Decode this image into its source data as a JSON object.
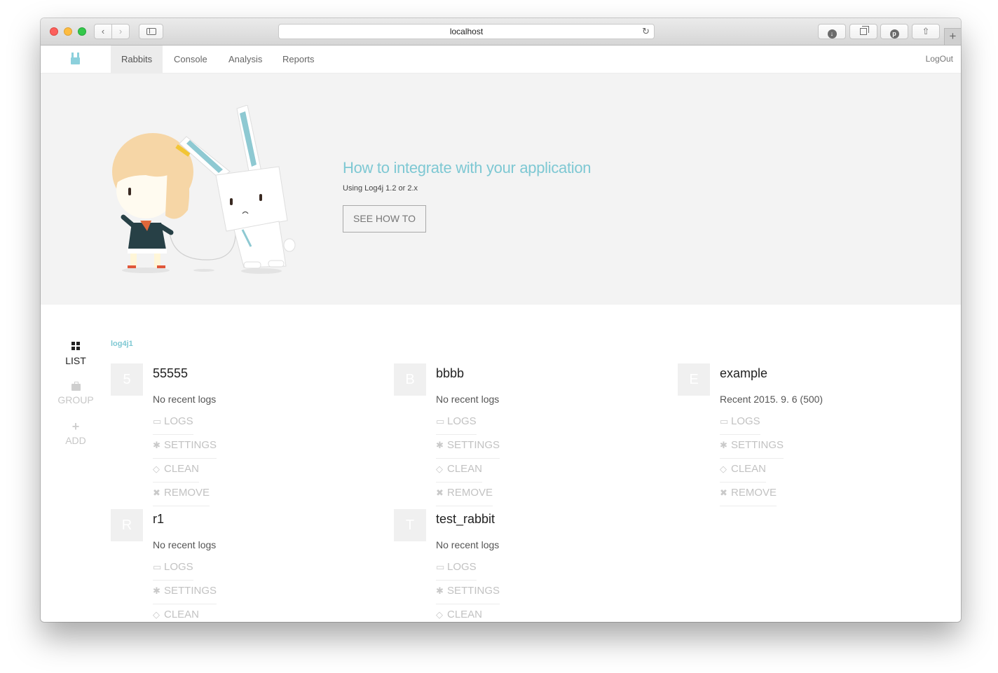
{
  "browser": {
    "url": "localhost",
    "back_icon": "‹",
    "forward_icon": "›",
    "reload_icon": "↻",
    "download_icon": "↓",
    "pinterest_icon": "p",
    "share_icon": "⇧",
    "new_tab_icon": "+"
  },
  "nav": {
    "items": [
      "Rabbits",
      "Console",
      "Analysis",
      "Reports"
    ],
    "logout": "LogOut"
  },
  "hero": {
    "title": "How to integrate with your application",
    "subtitle": "Using Log4j 1.2 or 2.x",
    "button": "SEE HOW TO"
  },
  "side_menu": {
    "list": "LIST",
    "group": "GROUP",
    "add": "ADD",
    "add_icon": "+"
  },
  "group_label": "log4j1",
  "actions": {
    "logs": "LOGS",
    "settings": "SETTINGS",
    "clean": "CLEAN",
    "remove": "REMOVE",
    "logs_icon": "▭",
    "settings_icon": "✱",
    "clean_icon": "◇",
    "remove_icon": "✖"
  },
  "rabbits": [
    {
      "initial": "5",
      "name": "55555",
      "status": "No recent logs"
    },
    {
      "initial": "B",
      "name": "bbbb",
      "status": "No recent logs"
    },
    {
      "initial": "E",
      "name": "example",
      "status": "Recent 2015. 9. 6 (500)"
    },
    {
      "initial": "R",
      "name": "r1",
      "status": "No recent logs"
    },
    {
      "initial": "T",
      "name": "test_rabbit",
      "status": "No recent logs"
    }
  ],
  "colors": {
    "accent": "#7ec8d3",
    "hero_bg": "#f3f3f3",
    "muted": "#c2c2c2"
  }
}
